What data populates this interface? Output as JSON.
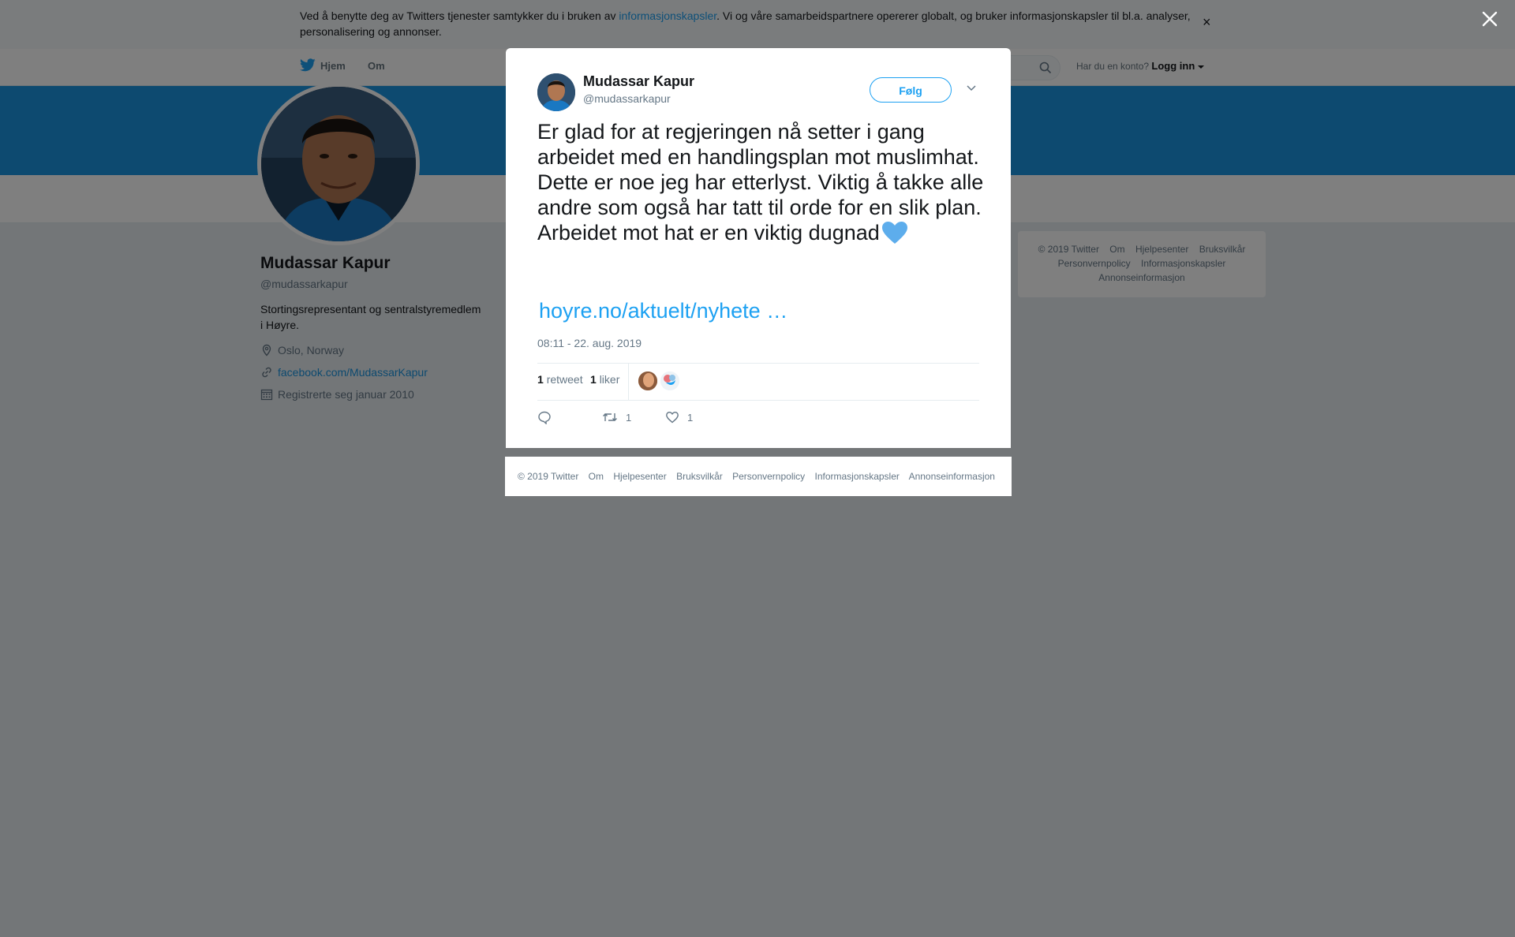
{
  "cookie_banner": {
    "text_before": "Ved å benytte deg av Twitters tjenester samtykker du i bruken av ",
    "link": "informasjonskapsler",
    "text_after": ". Vi og våre samarbeidspartnere opererer globalt, og bruker informasjonskapsler til bl.a. analyser, personalisering og annonser.",
    "close": "×"
  },
  "nav": {
    "home": "Hjem",
    "about": "Om",
    "login_prompt": "Har du en konto?",
    "login": "Logg inn"
  },
  "profile": {
    "name": "Mudassar Kapur",
    "handle": "@mudassarkapur",
    "bio": "Stortingsrepresentant og sentralstyremedlem i Høyre.",
    "location": "Oslo, Norway",
    "website": "facebook.com/MudassarKapur",
    "joined": "Registrerte seg januar 2010"
  },
  "side_footer": {
    "items": [
      "© 2019 Twitter",
      "Om",
      "Hjelpesenter",
      "Bruksvilkår",
      "Personvernpolicy",
      "Informasjonskapsler",
      "Annonseinformasjon"
    ]
  },
  "tweet": {
    "author_name": "Mudassar Kapur",
    "author_handle": "@mudassarkapur",
    "follow_label": "Følg",
    "text": "Er glad for at regjeringen nå setter i gang arbeidet med en handlingsplan mot muslimhat. Dette er noe jeg har etterlyst. Viktig å takke alle andre som også har tatt til orde for en slik plan. Arbeidet mot hat er en viktig dugnad",
    "link": "hoyre.no/aktuelt/nyhete …",
    "timestamp": "08:11 - 22. aug. 2019",
    "retweet_count": "1",
    "retweet_label": "retweet",
    "like_count": "1",
    "like_label": "liker",
    "action_retweets": "1",
    "action_likes": "1"
  },
  "modal_footer": {
    "items": [
      "© 2019 Twitter",
      "Om",
      "Hjelpesenter",
      "Bruksvilkår",
      "Personvernpolicy",
      "Informasjonskapsler",
      "Annonseinformasjon"
    ]
  },
  "colors": {
    "accent": "#1da1f2",
    "banner": "#1b95e0",
    "overlay": "rgba(0,0,0,0.5)"
  },
  "icons": [
    "twitter-bird-icon",
    "search-icon",
    "caret-down-icon",
    "close-icon",
    "location-pin-icon",
    "link-icon",
    "calendar-icon",
    "heart-emoji-icon",
    "reply-icon",
    "retweet-icon",
    "like-icon"
  ]
}
